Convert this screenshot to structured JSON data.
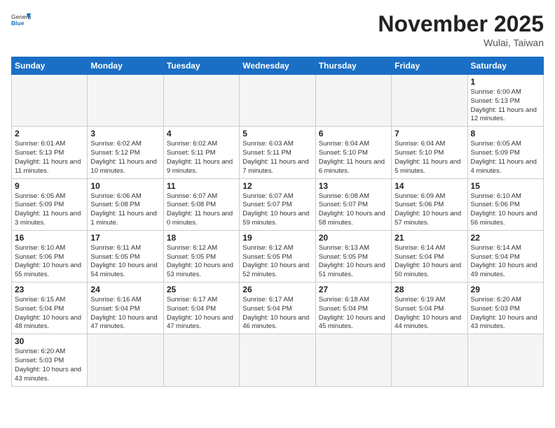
{
  "header": {
    "logo_general": "General",
    "logo_blue": "Blue",
    "month_year": "November 2025",
    "location": "Wulai, Taiwan"
  },
  "weekdays": [
    "Sunday",
    "Monday",
    "Tuesday",
    "Wednesday",
    "Thursday",
    "Friday",
    "Saturday"
  ],
  "weeks": [
    [
      {
        "day": "",
        "empty": true
      },
      {
        "day": "",
        "empty": true
      },
      {
        "day": "",
        "empty": true
      },
      {
        "day": "",
        "empty": true
      },
      {
        "day": "",
        "empty": true
      },
      {
        "day": "",
        "empty": true
      },
      {
        "day": "1",
        "sunrise": "6:00 AM",
        "sunset": "5:13 PM",
        "daylight": "11 hours and 12 minutes."
      }
    ],
    [
      {
        "day": "2",
        "sunrise": "6:01 AM",
        "sunset": "5:13 PM",
        "daylight": "11 hours and 11 minutes."
      },
      {
        "day": "3",
        "sunrise": "6:02 AM",
        "sunset": "5:12 PM",
        "daylight": "11 hours and 10 minutes."
      },
      {
        "day": "4",
        "sunrise": "6:02 AM",
        "sunset": "5:11 PM",
        "daylight": "11 hours and 9 minutes."
      },
      {
        "day": "5",
        "sunrise": "6:03 AM",
        "sunset": "5:11 PM",
        "daylight": "11 hours and 7 minutes."
      },
      {
        "day": "6",
        "sunrise": "6:04 AM",
        "sunset": "5:10 PM",
        "daylight": "11 hours and 6 minutes."
      },
      {
        "day": "7",
        "sunrise": "6:04 AM",
        "sunset": "5:10 PM",
        "daylight": "11 hours and 5 minutes."
      },
      {
        "day": "8",
        "sunrise": "6:05 AM",
        "sunset": "5:09 PM",
        "daylight": "11 hours and 4 minutes."
      }
    ],
    [
      {
        "day": "9",
        "sunrise": "6:05 AM",
        "sunset": "5:09 PM",
        "daylight": "11 hours and 3 minutes."
      },
      {
        "day": "10",
        "sunrise": "6:06 AM",
        "sunset": "5:08 PM",
        "daylight": "11 hours and 1 minute."
      },
      {
        "day": "11",
        "sunrise": "6:07 AM",
        "sunset": "5:08 PM",
        "daylight": "11 hours and 0 minutes."
      },
      {
        "day": "12",
        "sunrise": "6:07 AM",
        "sunset": "5:07 PM",
        "daylight": "10 hours and 59 minutes."
      },
      {
        "day": "13",
        "sunrise": "6:08 AM",
        "sunset": "5:07 PM",
        "daylight": "10 hours and 58 minutes."
      },
      {
        "day": "14",
        "sunrise": "6:09 AM",
        "sunset": "5:06 PM",
        "daylight": "10 hours and 57 minutes."
      },
      {
        "day": "15",
        "sunrise": "6:10 AM",
        "sunset": "5:06 PM",
        "daylight": "10 hours and 56 minutes."
      }
    ],
    [
      {
        "day": "16",
        "sunrise": "6:10 AM",
        "sunset": "5:06 PM",
        "daylight": "10 hours and 55 minutes."
      },
      {
        "day": "17",
        "sunrise": "6:11 AM",
        "sunset": "5:05 PM",
        "daylight": "10 hours and 54 minutes."
      },
      {
        "day": "18",
        "sunrise": "6:12 AM",
        "sunset": "5:05 PM",
        "daylight": "10 hours and 53 minutes."
      },
      {
        "day": "19",
        "sunrise": "6:12 AM",
        "sunset": "5:05 PM",
        "daylight": "10 hours and 52 minutes."
      },
      {
        "day": "20",
        "sunrise": "6:13 AM",
        "sunset": "5:05 PM",
        "daylight": "10 hours and 51 minutes."
      },
      {
        "day": "21",
        "sunrise": "6:14 AM",
        "sunset": "5:04 PM",
        "daylight": "10 hours and 50 minutes."
      },
      {
        "day": "22",
        "sunrise": "6:14 AM",
        "sunset": "5:04 PM",
        "daylight": "10 hours and 49 minutes."
      }
    ],
    [
      {
        "day": "23",
        "sunrise": "6:15 AM",
        "sunset": "5:04 PM",
        "daylight": "10 hours and 48 minutes."
      },
      {
        "day": "24",
        "sunrise": "6:16 AM",
        "sunset": "5:04 PM",
        "daylight": "10 hours and 47 minutes."
      },
      {
        "day": "25",
        "sunrise": "6:17 AM",
        "sunset": "5:04 PM",
        "daylight": "10 hours and 47 minutes."
      },
      {
        "day": "26",
        "sunrise": "6:17 AM",
        "sunset": "5:04 PM",
        "daylight": "10 hours and 46 minutes."
      },
      {
        "day": "27",
        "sunrise": "6:18 AM",
        "sunset": "5:04 PM",
        "daylight": "10 hours and 45 minutes."
      },
      {
        "day": "28",
        "sunrise": "6:19 AM",
        "sunset": "5:04 PM",
        "daylight": "10 hours and 44 minutes."
      },
      {
        "day": "29",
        "sunrise": "6:20 AM",
        "sunset": "5:03 PM",
        "daylight": "10 hours and 43 minutes."
      }
    ],
    [
      {
        "day": "30",
        "sunrise": "6:20 AM",
        "sunset": "5:03 PM",
        "daylight": "10 hours and 43 minutes."
      },
      {
        "day": "",
        "empty": true
      },
      {
        "day": "",
        "empty": true
      },
      {
        "day": "",
        "empty": true
      },
      {
        "day": "",
        "empty": true
      },
      {
        "day": "",
        "empty": true
      },
      {
        "day": "",
        "empty": true
      }
    ]
  ]
}
